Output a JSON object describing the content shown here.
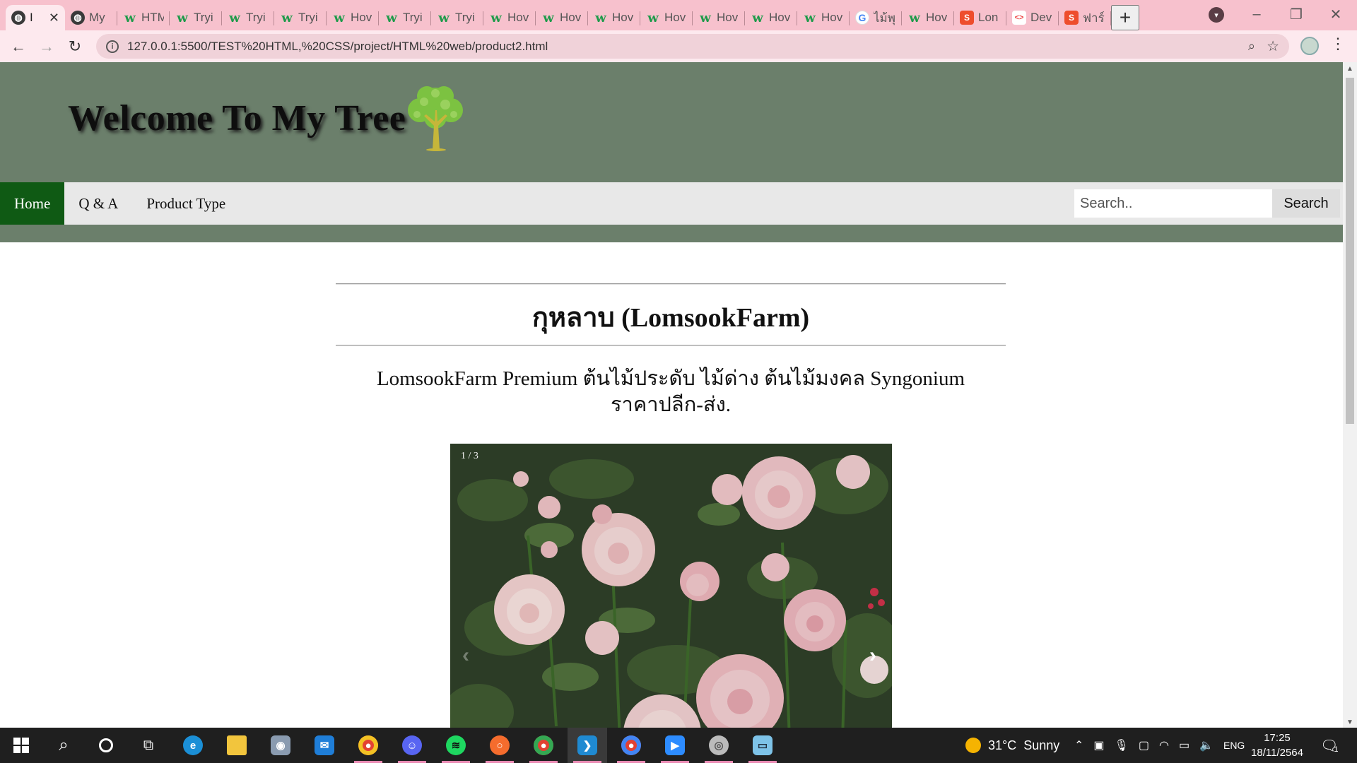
{
  "browser": {
    "tabs": [
      {
        "favicon": "globe-icon",
        "label": "I",
        "active": true
      },
      {
        "favicon": "globe-icon",
        "label": "My"
      },
      {
        "favicon": "w3schools-icon",
        "label": "HTM"
      },
      {
        "favicon": "w3schools-icon",
        "label": "Tryi"
      },
      {
        "favicon": "w3schools-icon",
        "label": "Tryi"
      },
      {
        "favicon": "w3schools-icon",
        "label": "Tryi"
      },
      {
        "favicon": "w3schools-icon",
        "label": "Hov"
      },
      {
        "favicon": "w3schools-icon",
        "label": "Tryi"
      },
      {
        "favicon": "w3schools-icon",
        "label": "Tryi"
      },
      {
        "favicon": "w3schools-icon",
        "label": "Hov"
      },
      {
        "favicon": "w3schools-icon",
        "label": "Hov"
      },
      {
        "favicon": "w3schools-icon",
        "label": "Hov"
      },
      {
        "favicon": "w3schools-icon",
        "label": "Hov"
      },
      {
        "favicon": "w3schools-icon",
        "label": "Hov"
      },
      {
        "favicon": "w3schools-icon",
        "label": "Hov"
      },
      {
        "favicon": "w3schools-icon",
        "label": "Hov"
      },
      {
        "favicon": "google-icon",
        "label": "ไม้พุ"
      },
      {
        "favicon": "w3schools-icon",
        "label": "Hov"
      },
      {
        "favicon": "shopee-icon",
        "label": "Lon"
      },
      {
        "favicon": "dev-icon",
        "label": "Dev"
      },
      {
        "favicon": "shopee-icon",
        "label": "ฟาร์"
      }
    ],
    "url": "127.0.0.1:5500/TEST%20HTML,%20CSS/project/HTML%20web/product2.html",
    "new_tab_symbol": "+",
    "close_symbol": "✕"
  },
  "site": {
    "title": "Welcome To My Tree",
    "nav": [
      {
        "label": "Home",
        "current": true
      },
      {
        "label": "Q & A"
      },
      {
        "label": "Product Type"
      }
    ],
    "search_placeholder": "Search..",
    "search_button": "Search",
    "header_color": "#6b7f6b",
    "nav_active_color": "#0f5a14"
  },
  "product": {
    "title": "กุหลาบ (LomsookFarm)",
    "description": "LomsookFarm Premium ต้นไม้ประดับ ไม้ด่าง ต้นไม้มงคล Syngonium ราคาปลีก-ส่ง.",
    "slide_counter": "1 / 3",
    "prev_symbol": "‹",
    "next_symbol": "›"
  },
  "taskbar": {
    "weather_temp": "31°C",
    "weather_text": "Sunny",
    "language": "ENG",
    "time": "17:25",
    "date": "18/11/2564",
    "notification_count": "1",
    "apps": [
      "start-icon",
      "search-icon",
      "cortana-icon",
      "task-view-icon",
      "edge-icon",
      "file-explorer-icon",
      "camera-icon",
      "mail-icon",
      "chrome-icon",
      "discord-icon",
      "spotify-icon",
      "origin-icon",
      "chrome-icon",
      "vscode-icon",
      "chrome-icon",
      "zoom-icon",
      "disc-icon",
      "notepad-icon"
    ]
  }
}
